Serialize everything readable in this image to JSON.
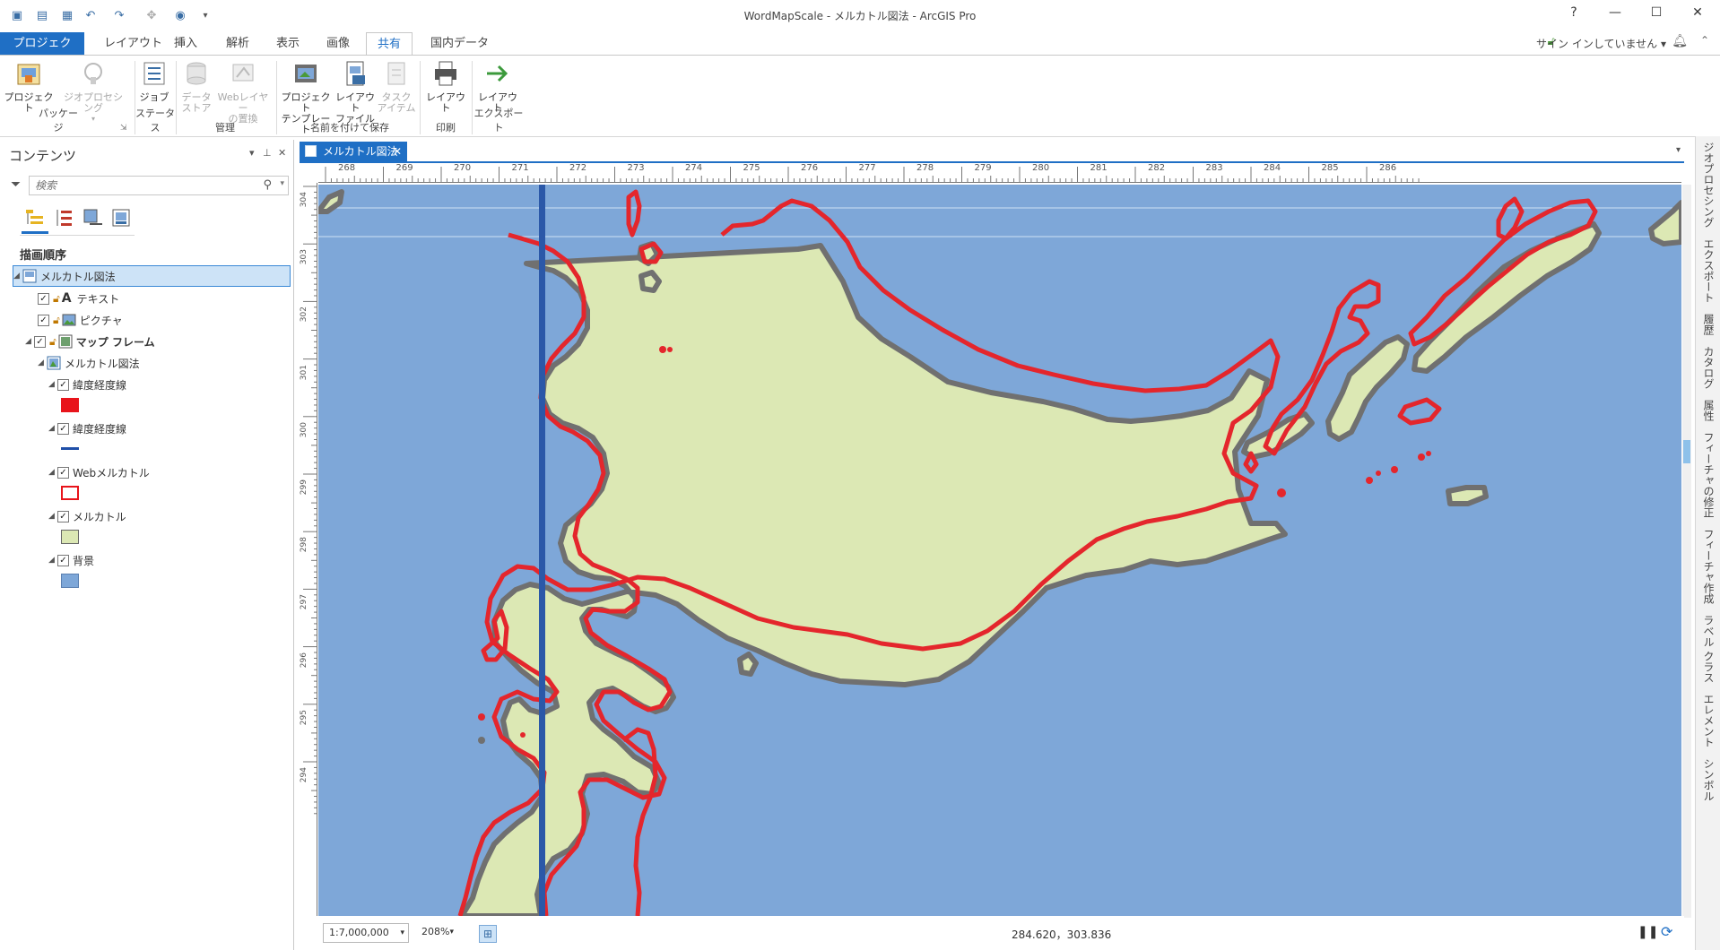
{
  "window": {
    "title": "WordMapScale - メルカトル図法 - ArcGIS Pro",
    "help": "?",
    "minimize": "—",
    "maximize": "☐",
    "close": "✕"
  },
  "tabs": {
    "project": "プロジェクト",
    "layout": "レイアウト",
    "insert": "挿入",
    "analysis": "解析",
    "view": "表示",
    "imagery": "画像",
    "share": "共有",
    "domestic": "国内データ"
  },
  "account": {
    "signin": "サイン インしていません"
  },
  "ribbon": {
    "project": "プロジェクト",
    "geoprocessing": "ジオプロセシング",
    "job": "ジョブ",
    "data_store": "データストア",
    "data_store_l1": "データ",
    "data_store_l2": "ストア",
    "web_layer_l1": "Webレイヤー",
    "web_layer_l2": "の置換",
    "project_template_l1": "プロジェクト",
    "project_template_l2": "テンプレート",
    "layout_file_l1": "レイアウト",
    "layout_file_l2": "ファイル",
    "task_item_l1": "タスク",
    "task_item_l2": "アイテム",
    "print_layout": "レイアウト",
    "export_layout": "レイアウト",
    "groups": {
      "package": "パッケージ",
      "status": "ステータス",
      "manage": "管理",
      "save_as": "名前を付けて保存",
      "print": "印刷",
      "export": "エクスポート"
    }
  },
  "contents": {
    "title": "コンテンツ",
    "search_placeholder": "検索",
    "draw_order": "描画順序",
    "items": {
      "root": "メルカトル図法",
      "text": "テキスト",
      "picture": "ピクチャ",
      "mapframe": "マップ フレーム",
      "map": "メルカトル図法",
      "graticule1": "緯度経度線",
      "graticule2": "緯度経度線",
      "webmerc": "Webメルカトル",
      "merc": "メルカトル",
      "background": "背景"
    },
    "colors": {
      "graticule_fill": "#e8141b",
      "graticule_line": "#1f4fa8",
      "webmerc_outline": "#e8141b",
      "merc_fill": "#dce8b4",
      "background": "#7ea7d8"
    }
  },
  "map": {
    "tab": "メルカトル図法",
    "scale": "1:7,000,000",
    "zoom": "208%",
    "coords": "284.620，303.836",
    "ruler_top": [
      "268",
      "269",
      "270",
      "271",
      "272",
      "273",
      "274",
      "275",
      "276",
      "277",
      "278",
      "279",
      "280",
      "281",
      "282",
      "283",
      "284",
      "285",
      "286"
    ],
    "ruler_left": [
      "304",
      "303",
      "302",
      "301",
      "300",
      "299",
      "298",
      "297",
      "296",
      "295",
      "294"
    ]
  },
  "dock": {
    "items": [
      "ジオプロセシング",
      "エクスポート",
      "履歴",
      "カタログ",
      "属性",
      "フィーチャの修正",
      "フィーチャ作成",
      "ラベル クラス",
      "エレメント",
      "シンボル"
    ]
  }
}
